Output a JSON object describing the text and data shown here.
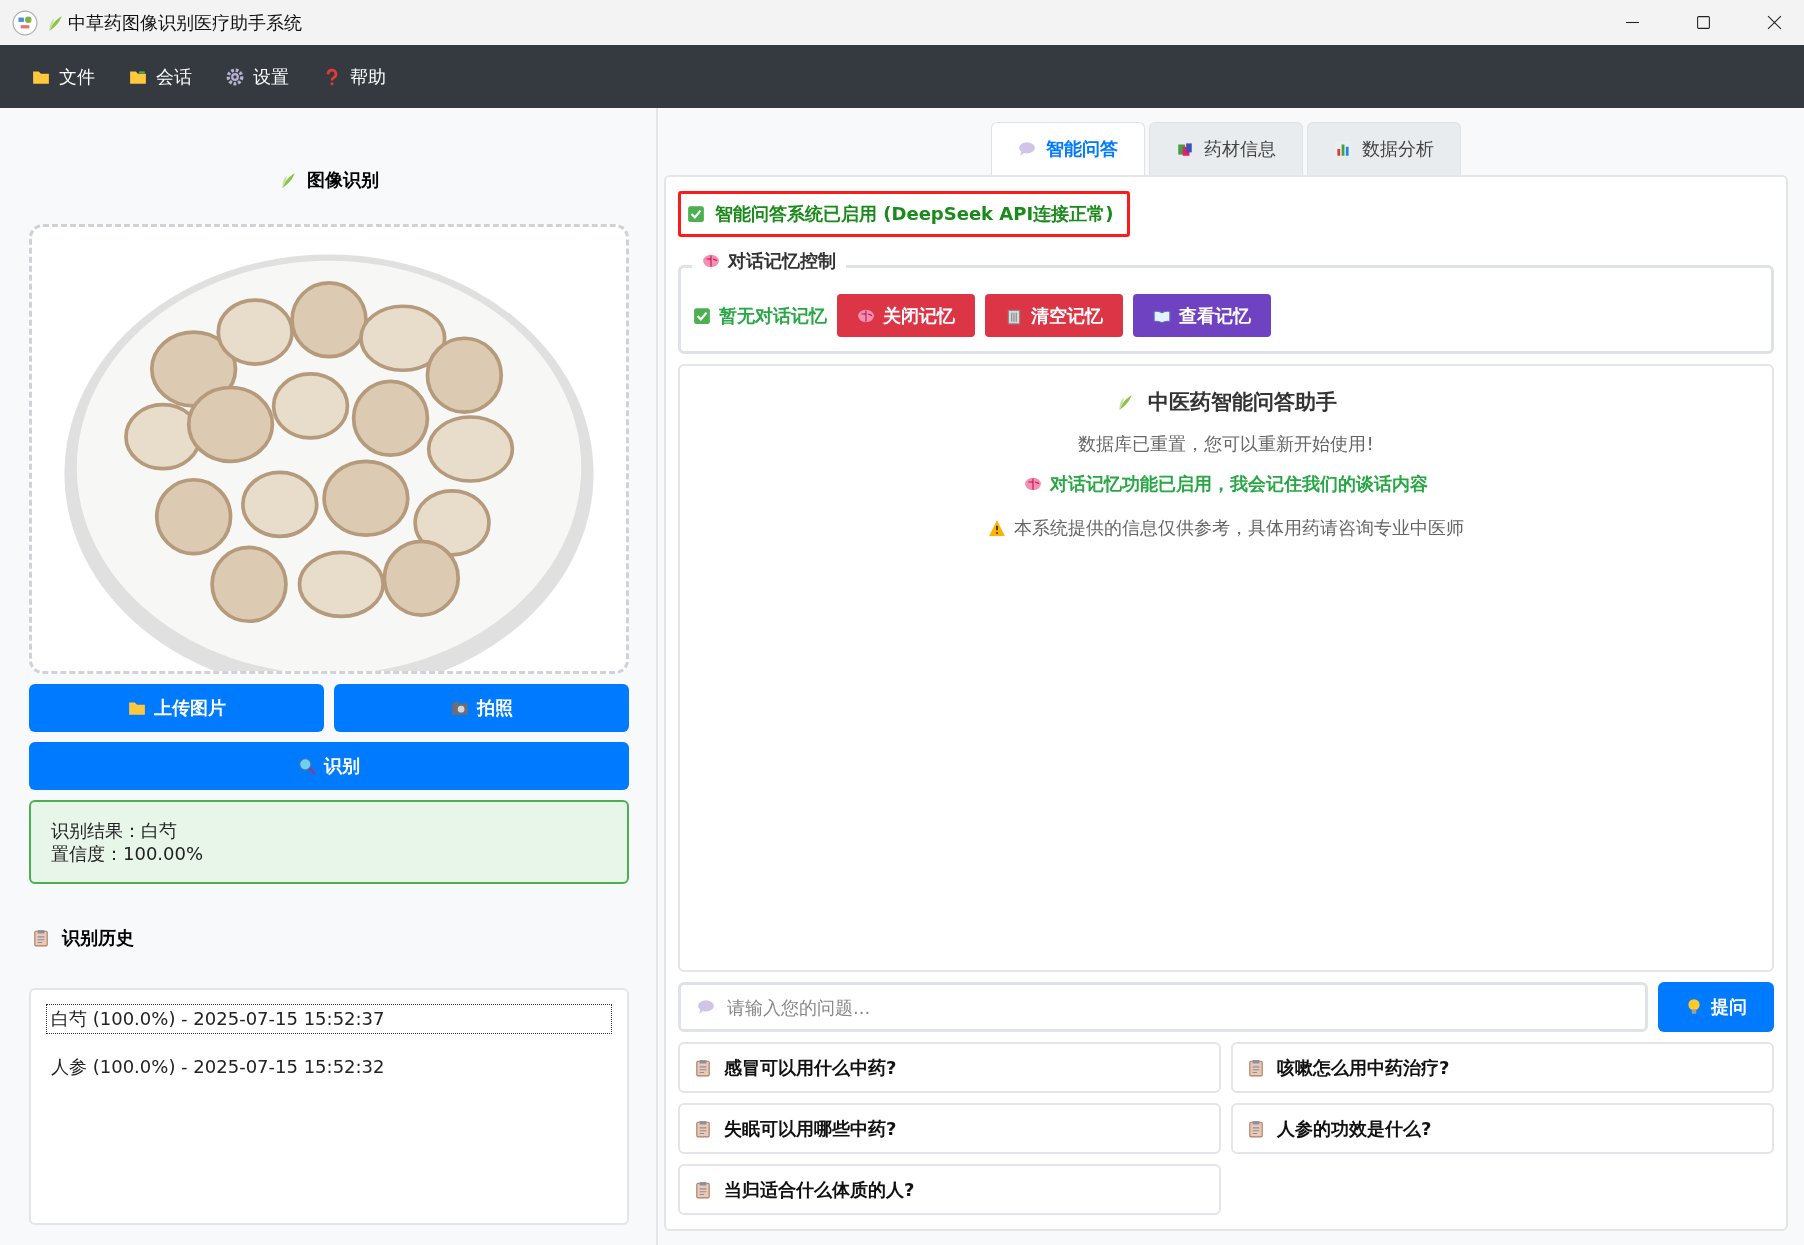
{
  "window": {
    "title": "中草药图像识别医疗助手系统"
  },
  "menu": [
    "文件",
    "会话",
    "设置",
    "帮助"
  ],
  "left": {
    "heading": "图像识别",
    "image": {
      "kind": "picture"
    },
    "buttons": [
      {
        "label": "上传图片"
      },
      {
        "label": "拍照"
      }
    ],
    "recognize_button": "识别",
    "result": [
      "识别结果：白芍",
      "置信度：100.00%"
    ],
    "history_title": "识别历史",
    "history": [
      {
        "text": "白芍 (100.0%) - 2025-07-15 15:52:37",
        "selected": true
      },
      {
        "text": "人参 (100.0%) - 2025-07-15 15:52:32",
        "selected": false
      }
    ]
  },
  "tabs": [
    {
      "label": "智能问答",
      "selected": true
    },
    {
      "label": "药材信息",
      "selected": false
    },
    {
      "label": "数据分析",
      "selected": false
    }
  ],
  "status": "智能问答系统已启用 (DeepSeek API连接正常)",
  "memory": {
    "title": "对话记忆控制",
    "state": "暂无对话记忆",
    "buttons": [
      {
        "label": "关闭记忆",
        "color": "#dc3545"
      },
      {
        "label": "清空记忆",
        "color": "#dc3545"
      },
      {
        "label": "查看记忆",
        "color": "#6f42c1"
      }
    ]
  },
  "welcome": {
    "title": "中医药智能问答助手",
    "subtitle": "数据库已重置，您可以重新开始使用!",
    "memory_note": "对话记忆功能已启用，我会记住我们的谈话内容",
    "disclaimer": "本系统提供的信息仅供参考，具体用药请咨询专业中医师"
  },
  "question_input": {
    "placeholder": "请输入您的问题..."
  },
  "ask_button": "提问",
  "quick_questions": [
    "感冒可以用什么中药?",
    "咳嗽怎么用中药治疗?",
    "失眠可以用哪些中药?",
    "人参的功效是什么?",
    "当归适合什么体质的人?"
  ]
}
